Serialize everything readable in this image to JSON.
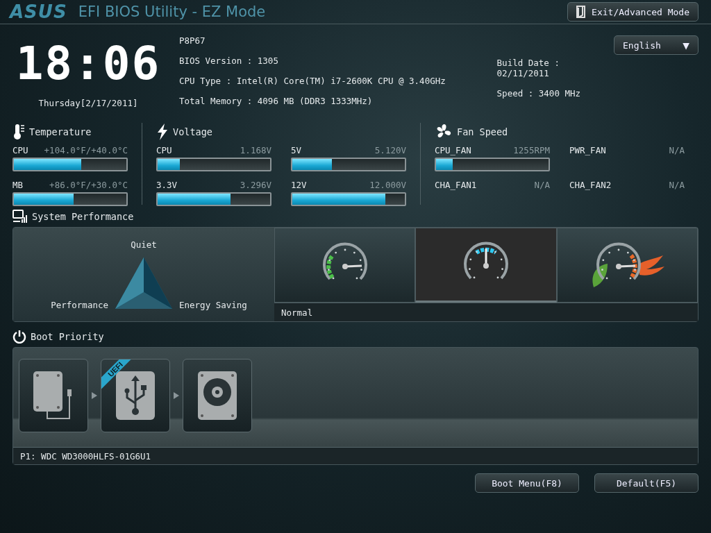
{
  "header": {
    "logo": "ASUS",
    "title": "EFI BIOS Utility - EZ Mode",
    "exit_button": "Exit/Advanced Mode"
  },
  "clock": {
    "time": "18:06",
    "date": "Thursday[2/17/2011]"
  },
  "info": {
    "model": "P8P67",
    "left": [
      "BIOS Version : 1305",
      "CPU Type : Intel(R) Core(TM) i7-2600K CPU @ 3.40GHz",
      "Total Memory : 4096 MB (DDR3 1333MHz)"
    ],
    "right": [
      "Build Date : 02/11/2011",
      "Speed : 3400 MHz"
    ]
  },
  "language": {
    "value": "English",
    "arrow": "▼"
  },
  "temperature": {
    "title": "Temperature",
    "items": [
      {
        "name": "CPU",
        "reading": "+104.0°F/+40.0°C",
        "level": 0.6
      },
      {
        "name": "MB",
        "reading": "+86.0°F/+30.0°C",
        "level": 0.53
      }
    ]
  },
  "voltage": {
    "title": "Voltage",
    "items": [
      {
        "name": "CPU",
        "reading": "1.168V",
        "level": 0.2
      },
      {
        "name": "5V",
        "reading": "5.120V",
        "level": 0.35
      },
      {
        "name": "3.3V",
        "reading": "3.296V",
        "level": 0.65
      },
      {
        "name": "12V",
        "reading": "12.000V",
        "level": 0.83
      }
    ]
  },
  "fan_speed": {
    "title": "Fan Speed",
    "items": [
      {
        "name": "CPU_FAN",
        "reading": "1255RPM",
        "kind": "bar",
        "level": 0.15
      },
      {
        "name": "PWR_FAN",
        "reading": "N/A",
        "kind": "text"
      },
      {
        "name": "CHA_FAN1",
        "reading": "N/A",
        "kind": "text"
      },
      {
        "name": "CHA_FAN2",
        "reading": "N/A",
        "kind": "text"
      }
    ]
  },
  "performance": {
    "title": "System Performance",
    "triangle_labels": {
      "top": "Quiet",
      "left": "Performance",
      "right": "Energy Saving"
    },
    "modes": [
      {
        "kind": "quiet",
        "selected": false
      },
      {
        "kind": "normal",
        "selected": true
      },
      {
        "kind": "saving",
        "selected": false
      }
    ],
    "current": "Normal"
  },
  "boot": {
    "title": "Boot Priority",
    "devices": [
      {
        "kind": "drive"
      },
      {
        "kind": "usb",
        "badge": "UEFI"
      },
      {
        "kind": "disk"
      }
    ],
    "current": "P1: WDC WD3000HLFS-01G6U1"
  },
  "buttons": [
    "Boot Menu(F8)",
    "Default(F5)"
  ]
}
